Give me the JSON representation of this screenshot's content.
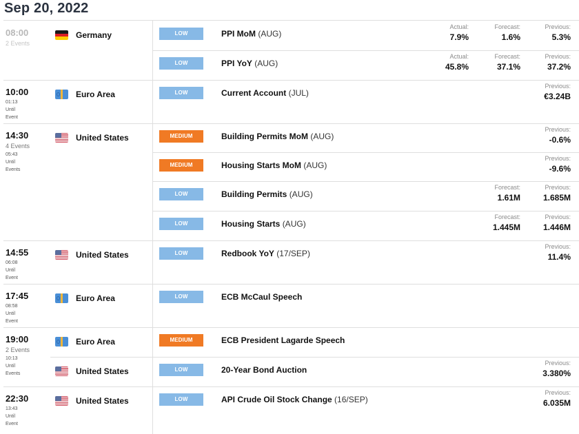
{
  "date": "Sep 20, 2022",
  "labels": {
    "actual": "Actual:",
    "forecast": "Forecast:",
    "previous": "Previous:"
  },
  "colors": {
    "low": "#87b9e6",
    "medium": "#f07a24"
  },
  "groups": [
    {
      "time": "08:00",
      "events_count": "2 Events",
      "past": true,
      "countdown": [],
      "events": [
        {
          "country": "Germany",
          "flag": "flag-germany",
          "impact": "LOW",
          "name": "PPI MoM",
          "period": "(AUG)",
          "actual": "7.9%",
          "forecast": "1.6%",
          "previous": "5.3%"
        },
        {
          "country": "",
          "flag": "",
          "impact": "LOW",
          "name": "PPI YoY",
          "period": "(AUG)",
          "actual": "45.8%",
          "forecast": "37.1%",
          "previous": "37.2%"
        }
      ]
    },
    {
      "time": "10:00",
      "events_count": "",
      "past": false,
      "countdown": [
        "01:13",
        "Until",
        "Event"
      ],
      "events": [
        {
          "country": "Euro Area",
          "flag": "flag-euro-area",
          "impact": "LOW",
          "name": "Current Account",
          "period": "(JUL)",
          "previous": "€3.24B"
        }
      ]
    },
    {
      "time": "14:30",
      "events_count": "4 Events",
      "past": false,
      "countdown": [
        "05:43",
        "Until",
        "Events"
      ],
      "events": [
        {
          "country": "United States",
          "flag": "flag-united-states",
          "impact": "MEDIUM",
          "name": "Building Permits MoM",
          "period": "(AUG)",
          "previous": "-0.6%"
        },
        {
          "country": "",
          "flag": "",
          "impact": "MEDIUM",
          "name": "Housing Starts MoM",
          "period": "(AUG)",
          "previous": "-9.6%"
        },
        {
          "country": "",
          "flag": "",
          "impact": "LOW",
          "name": "Building Permits",
          "period": "(AUG)",
          "forecast": "1.61M",
          "previous": "1.685M"
        },
        {
          "country": "",
          "flag": "",
          "impact": "LOW",
          "name": "Housing Starts",
          "period": "(AUG)",
          "forecast": "1.445M",
          "previous": "1.446M"
        }
      ]
    },
    {
      "time": "14:55",
      "events_count": "",
      "past": false,
      "countdown": [
        "06:08",
        "Until",
        "Event"
      ],
      "events": [
        {
          "country": "United States",
          "flag": "flag-united-states",
          "impact": "LOW",
          "name": "Redbook YoY",
          "period": "(17/SEP)",
          "previous": "11.4%"
        }
      ]
    },
    {
      "time": "17:45",
      "events_count": "",
      "past": false,
      "countdown": [
        "08:58",
        "Until",
        "Event"
      ],
      "events": [
        {
          "country": "Euro Area",
          "flag": "flag-euro-area",
          "impact": "LOW",
          "name": "ECB McCaul Speech",
          "period": ""
        }
      ]
    },
    {
      "time": "19:00",
      "events_count": "2 Events",
      "past": false,
      "countdown": [
        "10:13",
        "Until",
        "Events"
      ],
      "events": [
        {
          "country": "Euro Area",
          "flag": "flag-euro-area",
          "impact": "MEDIUM",
          "name": "ECB President Lagarde Speech",
          "period": ""
        },
        {
          "country": "United States",
          "flag": "flag-united-states",
          "impact": "LOW",
          "name": "20-Year Bond Auction",
          "period": "",
          "previous": "3.380%"
        }
      ]
    },
    {
      "time": "22:30",
      "events_count": "",
      "past": false,
      "countdown": [
        "13:43",
        "Until",
        "Event"
      ],
      "events": [
        {
          "country": "United States",
          "flag": "flag-united-states",
          "impact": "LOW",
          "name": "API Crude Oil Stock Change",
          "period": "(16/SEP)",
          "previous": "6.035M"
        }
      ]
    }
  ]
}
